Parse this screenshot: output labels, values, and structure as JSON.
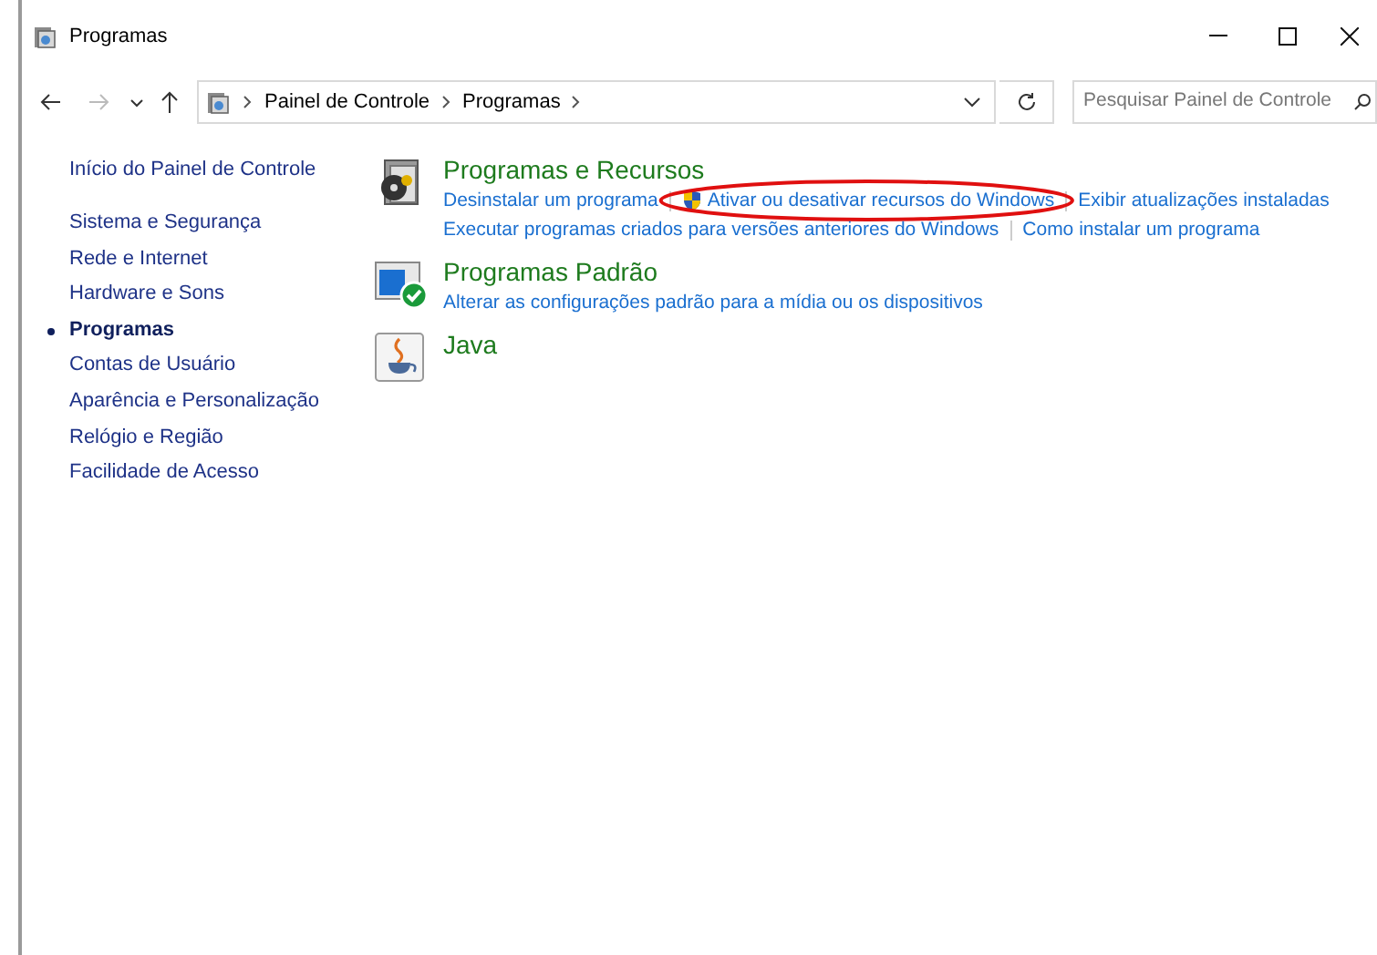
{
  "window": {
    "title": "Programas"
  },
  "address_bar": {
    "path": [
      "Painel de Controle",
      "Programas"
    ]
  },
  "search": {
    "placeholder": "Pesquisar Painel de Controle"
  },
  "sidebar": {
    "home": "Início do Painel de Controle",
    "items": [
      {
        "label": "Sistema e Segurança",
        "selected": false
      },
      {
        "label": "Rede e Internet",
        "selected": false
      },
      {
        "label": "Hardware e Sons",
        "selected": false
      },
      {
        "label": "Programas",
        "selected": true
      },
      {
        "label": "Contas de Usuário",
        "selected": false
      },
      {
        "label": "Aparência e Personalização",
        "selected": false
      },
      {
        "label": "Relógio e Região",
        "selected": false
      },
      {
        "label": "Facilidade de Acesso",
        "selected": false
      }
    ]
  },
  "sections": [
    {
      "kind": "programs",
      "title": "Programas e Recursos",
      "link_rows": [
        [
          {
            "text": "Desinstalar um programa",
            "shield": false,
            "circled": false
          },
          {
            "text": "Ativar ou desativar recursos do Windows",
            "shield": true,
            "circled": true
          },
          {
            "text": "Exibir atualizações instaladas",
            "shield": false,
            "circled": false
          }
        ],
        [
          {
            "text": "Executar programas criados para versões anteriores do Windows",
            "shield": false,
            "circled": false
          },
          {
            "text": "Como instalar um programa",
            "shield": false,
            "circled": false
          }
        ]
      ]
    },
    {
      "kind": "defaults",
      "title": "Programas Padrão",
      "link_rows": [
        [
          {
            "text": "Alterar as configurações padrão para a mídia ou os dispositivos",
            "shield": false,
            "circled": false
          }
        ]
      ]
    },
    {
      "kind": "java",
      "title": "Java"
    }
  ]
}
